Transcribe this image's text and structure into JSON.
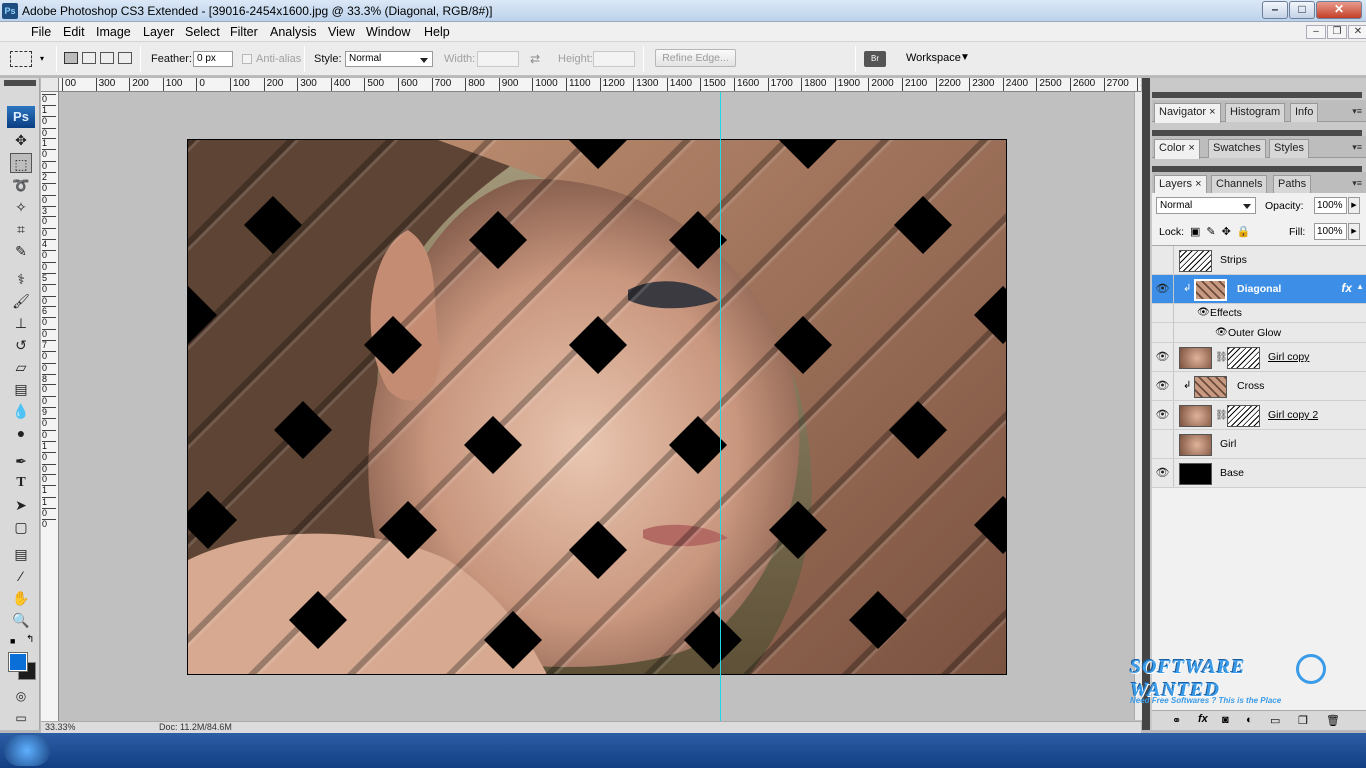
{
  "title_bar": {
    "app_icon": "Ps",
    "title": "Adobe Photoshop CS3 Extended - [39016-2454x1600.jpg @ 33.3% (Diagonal, RGB/8#)]",
    "minimize": "–",
    "maximize": "□",
    "close": "✕"
  },
  "menu": [
    "File",
    "Edit",
    "Image",
    "Layer",
    "Select",
    "Filter",
    "Analysis",
    "View",
    "Window",
    "Help"
  ],
  "doc_controls": {
    "minimize": "–",
    "restore": "❐",
    "close": "✕"
  },
  "options_bar": {
    "feather_label": "Feather:",
    "feather_value": "0 px",
    "anti_alias": "Anti-alias",
    "style_label": "Style:",
    "style_value": "Normal",
    "width_label": "Width:",
    "height_label": "Height:",
    "refine_edge": "Refine Edge...",
    "workspace": "Workspace"
  },
  "toolbox": {
    "logo": "Ps",
    "tools": [
      "move-icon",
      "marquee-icon",
      "lasso-icon",
      "magic-wand-icon",
      "crop-icon",
      "slice-icon",
      "healing-brush-icon",
      "brush-icon",
      "clone-stamp-icon",
      "history-brush-icon",
      "eraser-icon",
      "gradient-icon",
      "blur-icon",
      "dodge-icon",
      "pen-icon",
      "type-icon",
      "path-select-icon",
      "shape-icon",
      "notes-icon",
      "eyedropper-icon",
      "hand-icon",
      "zoom-icon"
    ],
    "foreground_color": "#0a6fd6",
    "background_color": "#1d1d1d"
  },
  "rulers": {
    "horizontal": [
      "00",
      "300",
      "200",
      "100",
      "0",
      "100",
      "200",
      "300",
      "400",
      "500",
      "600",
      "700",
      "800",
      "900",
      "1000",
      "1100",
      "1200",
      "1300",
      "1400",
      "1500",
      "1600",
      "1700",
      "1800",
      "1900",
      "2000",
      "2100",
      "2200",
      "2300",
      "2400",
      "2500",
      "2600",
      "2700",
      "28"
    ],
    "vertical": [
      "0",
      "1",
      "0",
      "0",
      "1",
      "0",
      "0",
      "2",
      "0",
      "0",
      "3",
      "0",
      "0",
      "4",
      "0",
      "0",
      "5",
      "0",
      "0",
      "6",
      "0",
      "0",
      "7",
      "0",
      "0",
      "8",
      "0",
      "0",
      "9",
      "0",
      "0",
      "1",
      "0",
      "0",
      "0",
      "1",
      "1",
      "0",
      "0"
    ]
  },
  "status": {
    "zoom": "33.33%",
    "doc": "Doc: 11.2M/84.6M"
  },
  "panels": {
    "group1_tabs": [
      "Navigator",
      "Histogram",
      "Info"
    ],
    "group2_tabs": [
      "Color",
      "Swatches",
      "Styles"
    ],
    "group3_tabs": [
      "Layers",
      "Channels",
      "Paths"
    ],
    "blend_mode": "Normal",
    "opacity_label": "Opacity:",
    "opacity_value": "100%",
    "lock_label": "Lock:",
    "fill_label": "Fill:",
    "fill_value": "100%",
    "layers": [
      {
        "name": "Strips",
        "visible": false
      },
      {
        "name": "Diagonal",
        "visible": true,
        "selected": true,
        "fx": "fx"
      },
      {
        "name": "Effects",
        "visible": true,
        "sub": true
      },
      {
        "name": "Outer Glow",
        "visible": true,
        "sub": true
      },
      {
        "name": "Girl copy",
        "visible": true
      },
      {
        "name": "Cross",
        "visible": true
      },
      {
        "name": "Girl copy 2",
        "visible": true
      },
      {
        "name": "Girl",
        "visible": false
      },
      {
        "name": "Base",
        "visible": true
      }
    ]
  },
  "watermark": {
    "line1": "SOFTWARE WANTED",
    "line2": "Need Free Softwares ? This is the Place"
  }
}
